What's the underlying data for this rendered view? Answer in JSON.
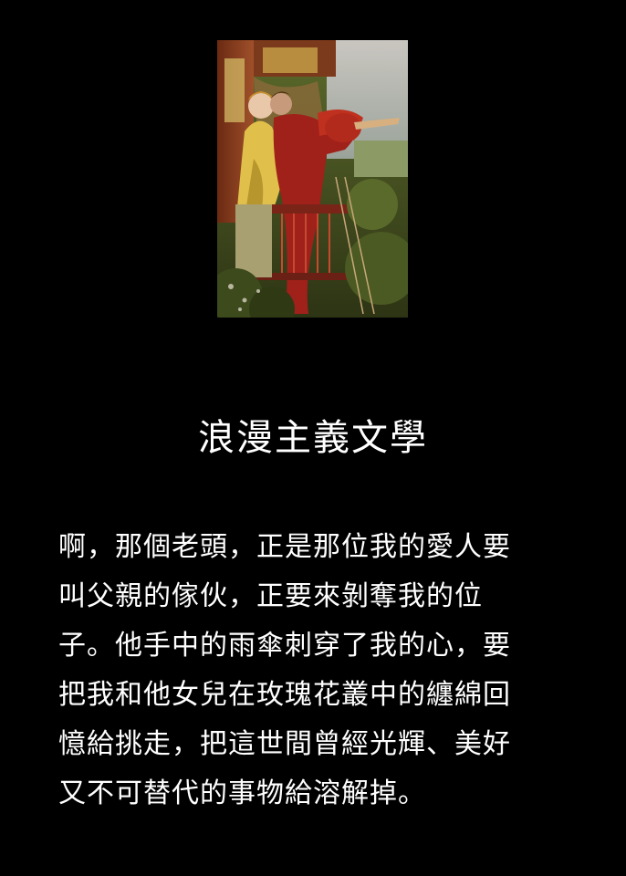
{
  "painting": {
    "description_icon": "romeo-and-juliet-balcony-painting"
  },
  "title": "浪漫主義文學",
  "paragraph_lines": [
    "啊，那個老頭，正是那位我的愛人要",
    "叫父親的傢伙，正要來剝奪我的位",
    "子。他手中的雨傘刺穿了我的心，要",
    "把我和他女兒在玫瑰花叢中的纏綿回",
    "憶給挑走，把這世間曾經光輝、美好",
    "又不可替代的事物給溶解掉。"
  ],
  "colors": {
    "background": "#000000",
    "text": "#ffffff"
  }
}
